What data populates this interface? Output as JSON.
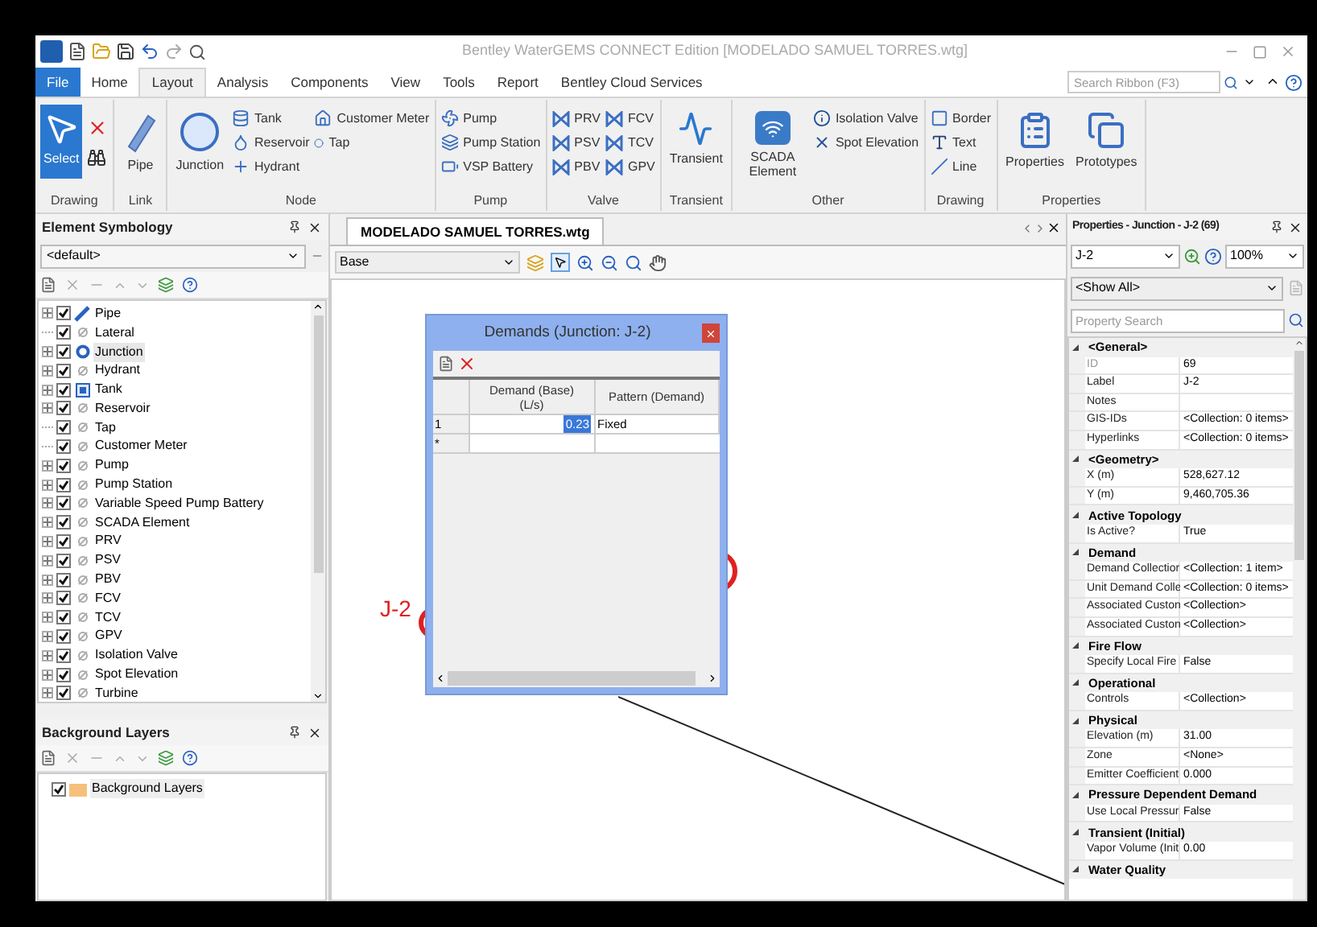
{
  "window": {
    "title": "Bentley WaterGEMS CONNECT Edition [MODELADO SAMUEL TORRES.wtg]"
  },
  "ribbon_tabs": [
    {
      "label": "File",
      "kind": "file",
      "selected": false
    },
    {
      "label": "Home",
      "kind": "tab",
      "selected": false
    },
    {
      "label": "Layout",
      "kind": "tab",
      "selected": true
    },
    {
      "label": "Analysis",
      "kind": "tab",
      "selected": false
    },
    {
      "label": "Components",
      "kind": "tab",
      "selected": false
    },
    {
      "label": "View",
      "kind": "tab",
      "selected": false
    },
    {
      "label": "Tools",
      "kind": "tab",
      "selected": false
    },
    {
      "label": "Report",
      "kind": "tab",
      "selected": false
    },
    {
      "label": "Bentley Cloud Services",
      "kind": "tab",
      "selected": false
    }
  ],
  "ribbon_search": {
    "placeholder": "Search Ribbon (F3)"
  },
  "ribbon_groups": [
    {
      "label": "Drawing",
      "items": [
        {
          "kind": "large",
          "label": "Select",
          "selected": true
        },
        {
          "kind": "tool"
        },
        {
          "kind": "tool"
        }
      ]
    },
    {
      "label": "Link",
      "items": [
        {
          "kind": "large",
          "label": "Pipe",
          "selected": false
        }
      ]
    },
    {
      "label": "Node",
      "items": [
        {
          "kind": "large",
          "label": "Junction",
          "selected": false
        },
        {
          "kind": "small",
          "label": "Tank"
        },
        {
          "kind": "small",
          "label": "Reservoir"
        },
        {
          "kind": "small",
          "label": "Hydrant"
        },
        {
          "kind": "small",
          "label": "Customer Meter"
        },
        {
          "kind": "small",
          "label": "Tap"
        }
      ]
    },
    {
      "label": "Pump",
      "items": [
        {
          "kind": "small",
          "label": "Pump"
        },
        {
          "kind": "small",
          "label": "Pump Station"
        },
        {
          "kind": "small",
          "label": "VSP Battery"
        }
      ]
    },
    {
      "label": "Valve",
      "items": [
        {
          "kind": "small",
          "label": "PRV"
        },
        {
          "kind": "small",
          "label": "PSV"
        },
        {
          "kind": "small",
          "label": "PBV"
        },
        {
          "kind": "small",
          "label": "FCV"
        },
        {
          "kind": "small",
          "label": "TCV"
        },
        {
          "kind": "small",
          "label": "GPV"
        }
      ]
    },
    {
      "label": "Transient",
      "items": [
        {
          "kind": "large",
          "label": "Transient",
          "selected": false
        }
      ]
    },
    {
      "label": "Other",
      "items": [
        {
          "kind": "large",
          "label": "SCADA Element",
          "selected": false
        },
        {
          "kind": "small",
          "label": "Isolation Valve"
        },
        {
          "kind": "small",
          "label": "Spot Elevation"
        }
      ]
    },
    {
      "label": "Drawing",
      "items": [
        {
          "kind": "small",
          "label": "Border"
        },
        {
          "kind": "small",
          "label": "Text"
        },
        {
          "kind": "small",
          "label": "Line"
        }
      ]
    },
    {
      "label": "Properties",
      "items": [
        {
          "kind": "large",
          "label": "Properties",
          "selected": false
        },
        {
          "kind": "large",
          "label": "Prototypes",
          "selected": false
        }
      ]
    }
  ],
  "element_symbology": {
    "title": "Element Symbology",
    "dropdown": "<default>",
    "items": [
      {
        "label": "Pipe",
        "checked": true,
        "expandable": true,
        "selected": false
      },
      {
        "label": "Lateral",
        "checked": true,
        "expandable": false,
        "selected": false
      },
      {
        "label": "Junction",
        "checked": true,
        "expandable": true,
        "selected": true
      },
      {
        "label": "Hydrant",
        "checked": true,
        "expandable": true,
        "selected": false
      },
      {
        "label": "Tank",
        "checked": true,
        "expandable": true,
        "selected": false
      },
      {
        "label": "Reservoir",
        "checked": true,
        "expandable": true,
        "selected": false
      },
      {
        "label": "Tap",
        "checked": true,
        "expandable": false,
        "selected": false
      },
      {
        "label": "Customer Meter",
        "checked": true,
        "expandable": false,
        "selected": false
      },
      {
        "label": "Pump",
        "checked": true,
        "expandable": true,
        "selected": false
      },
      {
        "label": "Pump Station",
        "checked": true,
        "expandable": true,
        "selected": false
      },
      {
        "label": "Variable Speed Pump Battery",
        "checked": true,
        "expandable": true,
        "selected": false
      },
      {
        "label": "SCADA Element",
        "checked": true,
        "expandable": true,
        "selected": false
      },
      {
        "label": "PRV",
        "checked": true,
        "expandable": true,
        "selected": false
      },
      {
        "label": "PSV",
        "checked": true,
        "expandable": true,
        "selected": false
      },
      {
        "label": "PBV",
        "checked": true,
        "expandable": true,
        "selected": false
      },
      {
        "label": "FCV",
        "checked": true,
        "expandable": true,
        "selected": false
      },
      {
        "label": "TCV",
        "checked": true,
        "expandable": true,
        "selected": false
      },
      {
        "label": "GPV",
        "checked": true,
        "expandable": true,
        "selected": false
      },
      {
        "label": "Isolation Valve",
        "checked": true,
        "expandable": true,
        "selected": false
      },
      {
        "label": "Spot Elevation",
        "checked": true,
        "expandable": true,
        "selected": false
      },
      {
        "label": "Turbine",
        "checked": true,
        "expandable": true,
        "selected": false
      }
    ]
  },
  "background_layers": {
    "title": "Background Layers",
    "items": [
      {
        "label": "Background Layers",
        "checked": true
      }
    ]
  },
  "document": {
    "tab": "MODELADO SAMUEL TORRES.wtg",
    "scenario": "Base",
    "node_label": "J-2"
  },
  "dialog": {
    "title": "Demands (Junction: J-2)",
    "columns": [
      "Demand (Base)\n(L/s)",
      "Pattern (Demand)"
    ],
    "rows": [
      {
        "header": "1",
        "cells": [
          "0.23",
          "Fixed"
        ]
      }
    ],
    "new_row": "*"
  },
  "properties": {
    "title": "Properties - Junction - J-2 (69)",
    "element": "J-2",
    "zoom": "100%",
    "filter": "<Show All>",
    "search": {
      "placeholder": "Property Search"
    },
    "sections": [
      {
        "title": "<General>",
        "expanded": true,
        "rows": [
          {
            "name": "ID",
            "value": "69",
            "readonly": true
          },
          {
            "name": "Label",
            "value": "J-2",
            "readonly": false
          },
          {
            "name": "Notes",
            "readonly": false
          },
          {
            "name": "GIS-IDs",
            "value": "<Collection: 0 items>",
            "readonly": false
          },
          {
            "name": "Hyperlinks",
            "value": "<Collection: 0 items>",
            "readonly": false
          }
        ]
      },
      {
        "title": "<Geometry>",
        "expanded": true,
        "rows": [
          {
            "name": "X (m)",
            "value": "528,627.12",
            "readonly": false
          },
          {
            "name": "Y (m)",
            "value": "9,460,705.36",
            "readonly": false
          }
        ]
      },
      {
        "title": "Active Topology",
        "expanded": true,
        "rows": [
          {
            "name": "Is Active?",
            "value": "True",
            "readonly": false
          }
        ]
      },
      {
        "title": "Demand",
        "expanded": true,
        "rows": [
          {
            "name": "Demand Collectior",
            "value": "<Collection: 1 item>",
            "readonly": false
          },
          {
            "name": "Unit Demand Colle",
            "value": "<Collection: 0 items>",
            "readonly": false
          },
          {
            "name": "Associated Custon",
            "value": "<Collection>",
            "readonly": false
          },
          {
            "name": "Associated Custon",
            "value": "<Collection>",
            "readonly": false
          }
        ]
      },
      {
        "title": "Fire Flow",
        "expanded": true,
        "rows": [
          {
            "name": "Specify Local Fire",
            "value": "False",
            "readonly": false
          }
        ]
      },
      {
        "title": "Operational",
        "expanded": true,
        "rows": [
          {
            "name": "Controls",
            "value": "<Collection>",
            "readonly": false
          }
        ]
      },
      {
        "title": "Physical",
        "expanded": true,
        "rows": [
          {
            "name": "Elevation (m)",
            "value": "31.00",
            "readonly": false
          },
          {
            "name": "Zone",
            "value": "<None>",
            "readonly": false
          },
          {
            "name": "Emitter Coefficient",
            "value": "0.000",
            "readonly": false
          }
        ]
      },
      {
        "title": "Pressure Dependent Demand",
        "expanded": true,
        "rows": [
          {
            "name": "Use Local Pressur",
            "value": "False",
            "readonly": false
          }
        ]
      },
      {
        "title": "Transient (Initial)",
        "expanded": true,
        "rows": [
          {
            "name": "Vapor Volume (Init",
            "value": "0.00",
            "readonly": false
          }
        ]
      },
      {
        "title": "Water Quality",
        "expanded": true
      }
    ]
  }
}
